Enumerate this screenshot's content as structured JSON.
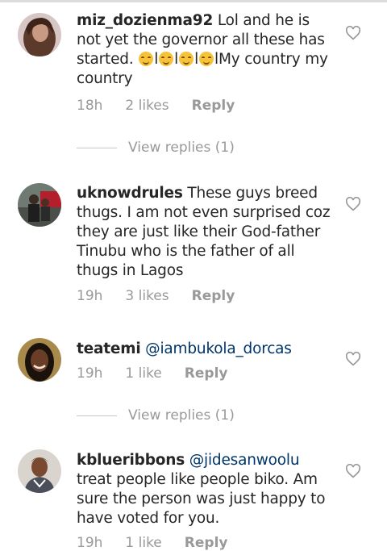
{
  "comments": [
    {
      "username": "miz_dozienma92",
      "text_before": "Lol and he is not yet the governor all these has started.",
      "text_after": "My country my country",
      "separator": "l",
      "time": "18h",
      "likes": "2 likes",
      "reply": "Reply",
      "view_replies": "View replies (1)"
    },
    {
      "username": "uknowdrules",
      "text": "These guys breed thugs. I am not even surprised coz they are just like their God-father Tinubu who is the father of all thugs in Lagos",
      "time": "19h",
      "likes": "3 likes",
      "reply": "Reply"
    },
    {
      "username": "teatemi",
      "mention": "@iambukola_dorcas",
      "time": "19h",
      "likes": "1 like",
      "reply": "Reply",
      "view_replies": "View replies (1)"
    },
    {
      "username": "kblueribbons",
      "mention": "@jidesanwoolu",
      "text": "treat people like people biko. Am sure the person was just happy to have voted for you.",
      "time": "19h",
      "likes": "1 like",
      "reply": "Reply"
    }
  ],
  "icons": {
    "like": "heart-outline-icon",
    "emoji": "smiling-face-emoji"
  },
  "colors": {
    "text": "#262626",
    "meta": "#999999",
    "mention": "#003569"
  }
}
